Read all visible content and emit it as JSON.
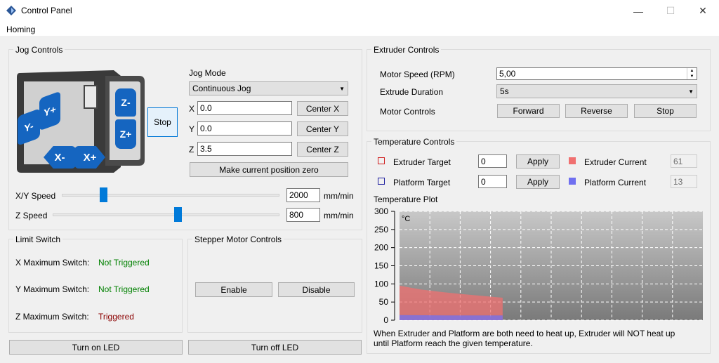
{
  "window": {
    "title": "Control Panel",
    "minimize": "—",
    "maximize": "☐",
    "close": "✕"
  },
  "menu": {
    "homing": "Homing"
  },
  "jog": {
    "title": "Jog Controls",
    "mode_label": "Jog Mode",
    "mode_value": "Continuous Jog",
    "stop": "Stop",
    "x_label": "X",
    "x_value": "0.0",
    "center_x": "Center X",
    "y_label": "Y",
    "y_value": "0.0",
    "center_y": "Center Y",
    "z_label": "Z",
    "z_value": "3.5",
    "center_z": "Center Z",
    "make_zero": "Make current position zero",
    "xy_speed_label": "X/Y Speed",
    "xy_speed_value": "2000",
    "xy_speed_unit": "mm/min",
    "xy_speed_slider_fraction": 0.19,
    "z_speed_label": "Z Speed",
    "z_speed_value": "800",
    "z_speed_unit": "mm/min",
    "z_speed_slider_fraction": 0.55,
    "pad": {
      "y_minus": "Y-",
      "y_plus": "Y+",
      "x_minus": "X-",
      "x_plus": "X+",
      "z_minus": "Z-",
      "z_plus": "Z+"
    }
  },
  "limit": {
    "title": "Limit Switch",
    "x_label": "X Maximum Switch:",
    "x_status": "Not Triggered",
    "y_label": "Y Maximum Switch:",
    "y_status": "Not Triggered",
    "z_label": "Z Maximum Switch:",
    "z_status": "Triggered"
  },
  "stepper": {
    "title": "Stepper Motor Controls",
    "enable": "Enable",
    "disable": "Disable"
  },
  "led": {
    "on": "Turn on LED",
    "off": "Turn off LED"
  },
  "extruder": {
    "title": "Extruder Controls",
    "speed_label": "Motor Speed (RPM)",
    "speed_value": "5,00",
    "duration_label": "Extrude Duration",
    "duration_value": "5s",
    "motor_label": "Motor Controls",
    "forward": "Forward",
    "reverse": "Reverse",
    "stop": "Stop"
  },
  "temperature": {
    "title": "Temperature Controls",
    "extruder_target_label": "Extruder Target",
    "extruder_target_value": "0",
    "apply1": "Apply",
    "platform_target_label": "Platform Target",
    "platform_target_value": "0",
    "apply2": "Apply",
    "extruder_current_label": "Extruder Current",
    "extruder_current_value": "61",
    "platform_current_label": "Platform Current",
    "platform_current_value": "13",
    "plot_label": "Temperature Plot",
    "note1": "When Extruder and Platform are both need to heat up, Extruder will NOT heat up",
    "note2": "until Platform reach the given temperature.",
    "colors": {
      "extruder": "#f07070",
      "platform": "#7070f0",
      "extruder_target": "#d02020",
      "platform_target": "#2020a0"
    }
  },
  "chart_data": {
    "type": "area",
    "ylabel": "°C",
    "ylim": [
      0,
      300
    ],
    "yticks": [
      "300",
      "250",
      "200",
      "150",
      "100",
      "50",
      "0"
    ],
    "grid": true,
    "series": [
      {
        "points": [
          [
            0,
            95
          ],
          [
            0.2,
            85
          ],
          [
            0.4,
            78
          ],
          [
            0.6,
            72
          ],
          [
            1.0,
            62
          ]
        ]
      },
      {
        "points": [
          [
            0,
            14
          ],
          [
            0.5,
            13
          ],
          [
            1.0,
            13
          ]
        ]
      }
    ]
  }
}
